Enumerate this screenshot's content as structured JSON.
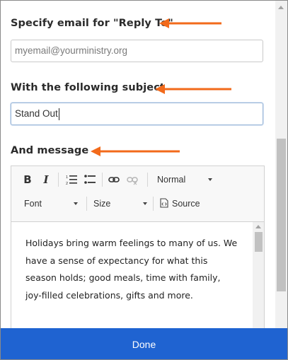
{
  "reply_to": {
    "label": "Specify email for \"Reply To\"",
    "placeholder": "myemail@yourministry.org",
    "value": ""
  },
  "subject": {
    "label": "With the following subject",
    "value": "Stand Out"
  },
  "message": {
    "label": "And message",
    "toolbar": {
      "bold_icon": "B",
      "italic_icon": "I",
      "format_value": "Normal",
      "font_value": "Font",
      "size_value": "Size",
      "source_label": "Source"
    },
    "body": "Holidays bring warm feelings to many of us. We have a sense of expectancy for what this season holds; good meals, time with family, joy-filled celebrations, gifts and more."
  },
  "done_label": "Done",
  "colors": {
    "arrow": "#f26a1b",
    "primary": "#1f63d1"
  }
}
